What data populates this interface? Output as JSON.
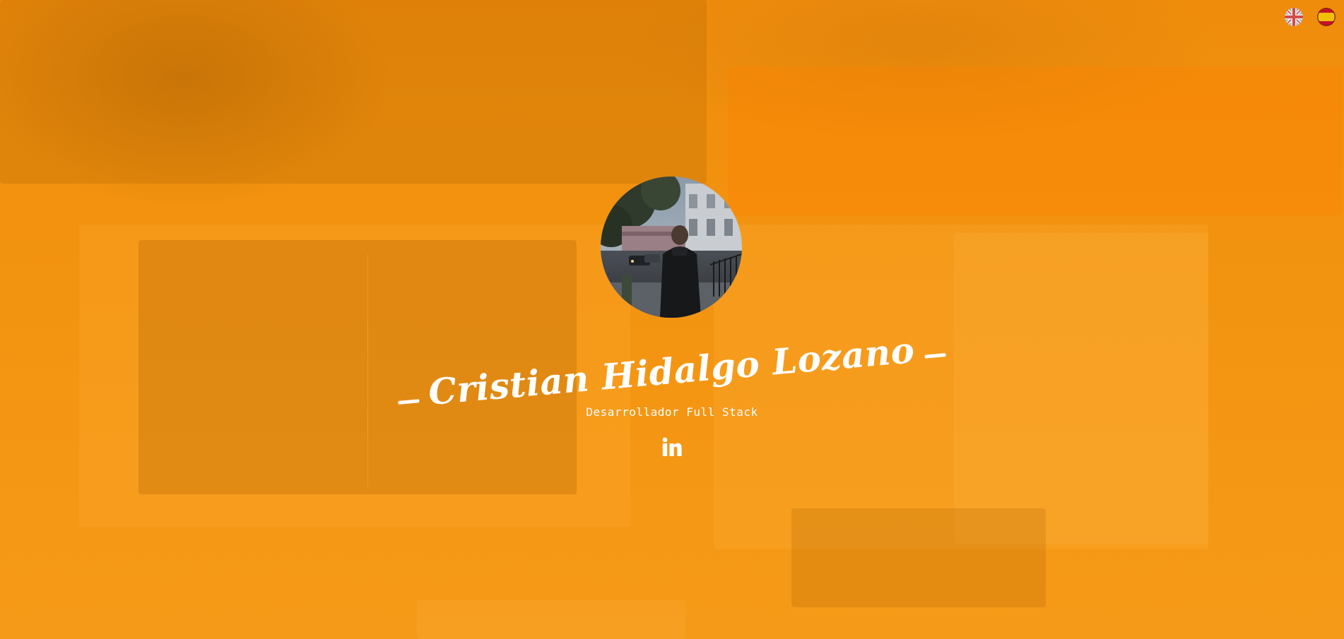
{
  "profile": {
    "name": "Cristian Hidalgo Lozano",
    "title": "Desarrollador Full Stack",
    "avatar_alt": "Cristian Hidalgo Lozano"
  },
  "language_switcher": {
    "options": [
      {
        "code": "en",
        "icon": "uk-flag-icon"
      },
      {
        "code": "es",
        "icon": "spain-flag-icon"
      }
    ]
  },
  "social": {
    "links": [
      {
        "label": "LinkedIn",
        "icon": "linkedin-icon"
      }
    ]
  },
  "colors": {
    "background": "#f4920f",
    "text": "#ffffff"
  }
}
